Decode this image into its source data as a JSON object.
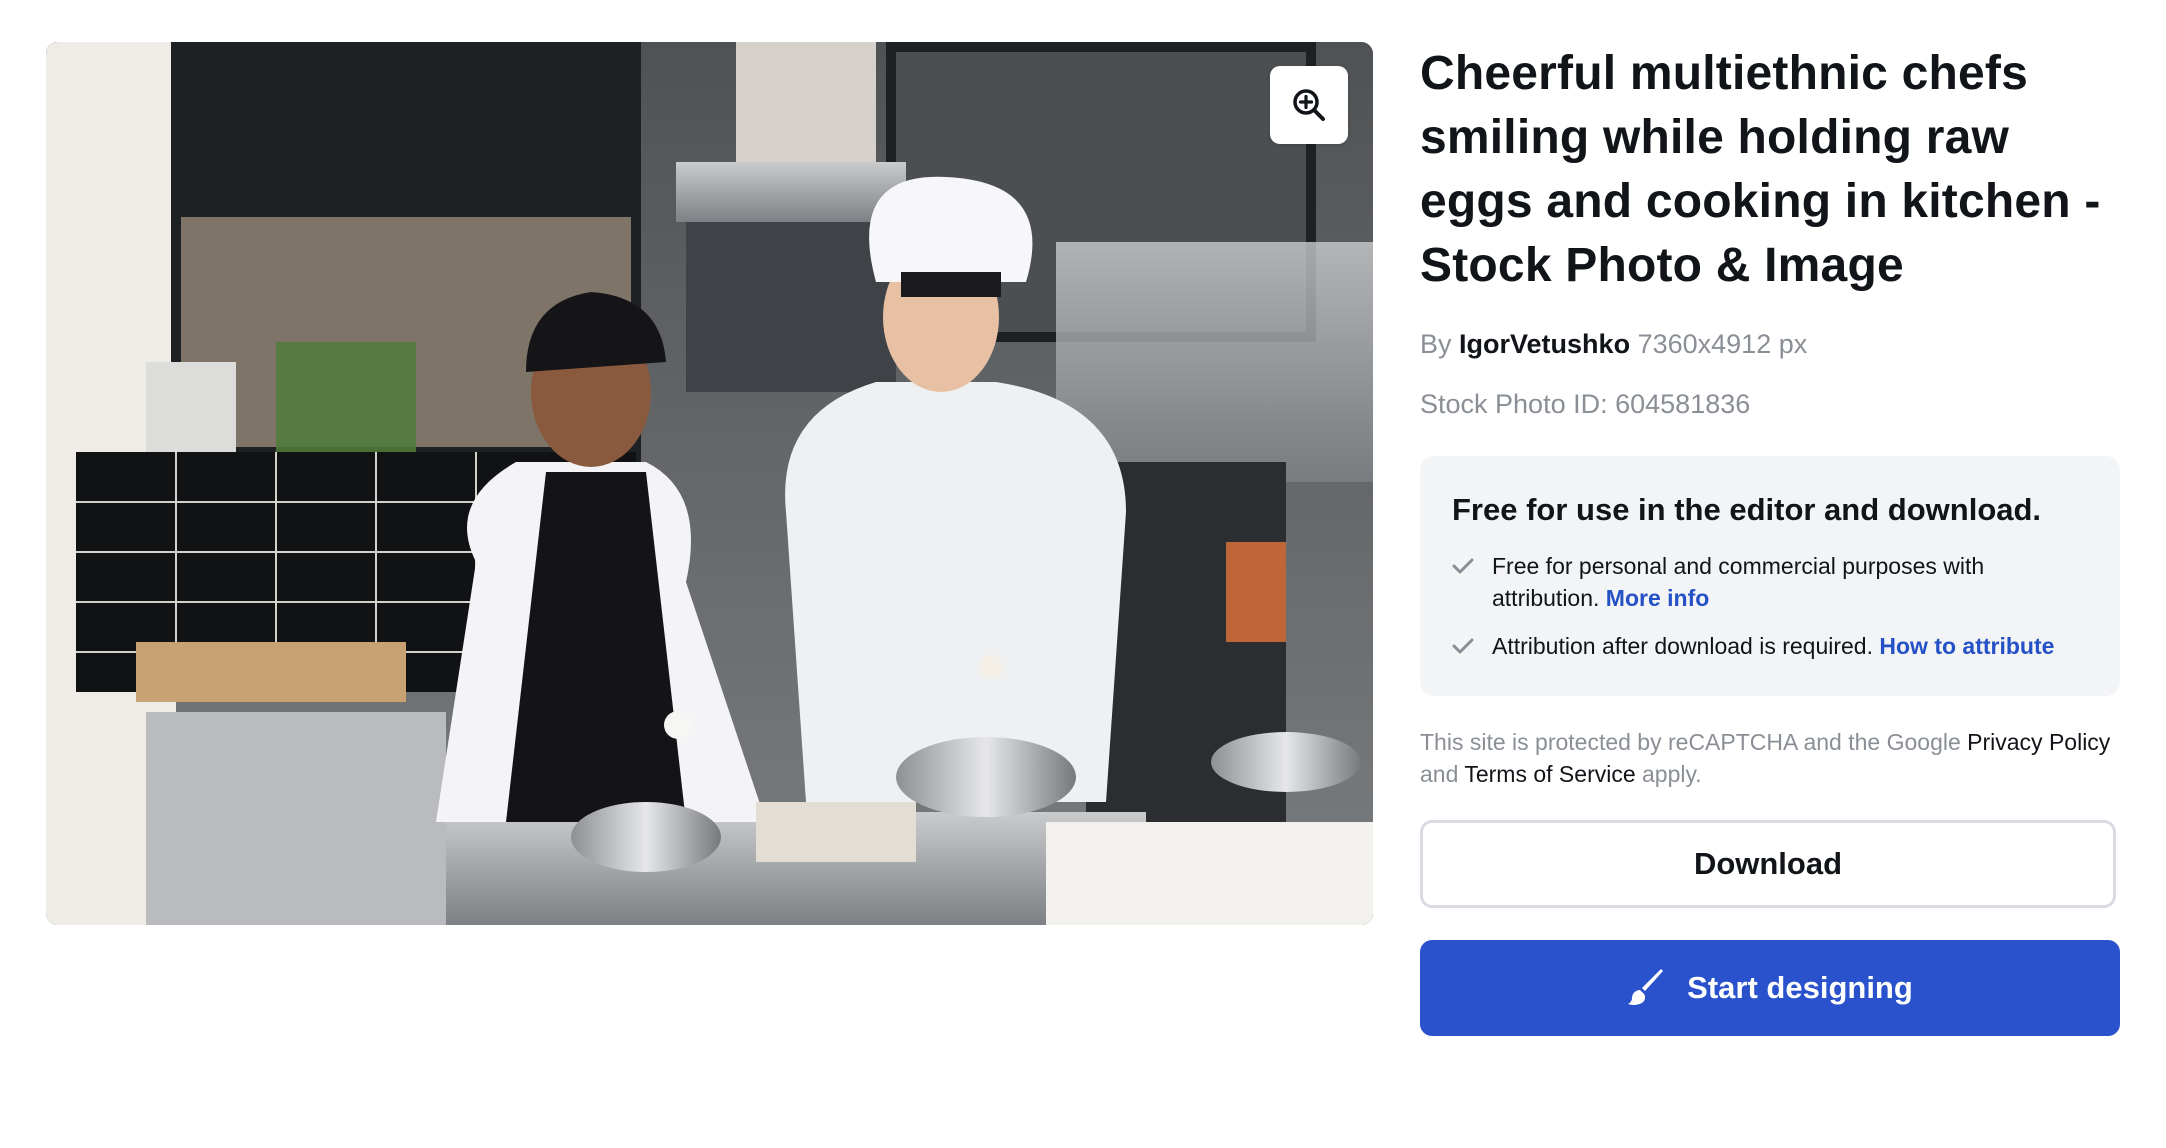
{
  "photo": {
    "alt": "Cheerful multiethnic chefs smiling while holding raw eggs and cooking in kitchen",
    "zoom_icon": "zoom-in-icon"
  },
  "details": {
    "title": "Cheerful multiethnic chefs smiling while holding raw eggs and cooking in kitchen - Stock Photo & Image",
    "by_label": "By",
    "author": "IgorVetushko",
    "dimensions": "7360x4912 px",
    "stock_id_label": "Stock Photo ID:",
    "stock_id": "604581836"
  },
  "license": {
    "heading": "Free for use in the editor and download.",
    "item1_text": "Free for personal and commercial purposes with attribution.",
    "item1_link": "More info",
    "item2_text": "Attribution after download is required.",
    "item2_link": "How to attribute",
    "check_icon": "check-icon"
  },
  "captcha": {
    "prefix": "This site is protected by reCAPTCHA and the Google",
    "privacy": "Privacy Policy",
    "and": "and",
    "terms": "Terms of Service",
    "suffix": "apply."
  },
  "actions": {
    "download_label": "Download",
    "design_label": "Start designing",
    "design_icon": "brush-icon"
  },
  "colors": {
    "accent": "#2a52cc",
    "link": "#2451c6",
    "muted_text": "#8a8f96",
    "panel_bg": "#f3f4f6"
  }
}
